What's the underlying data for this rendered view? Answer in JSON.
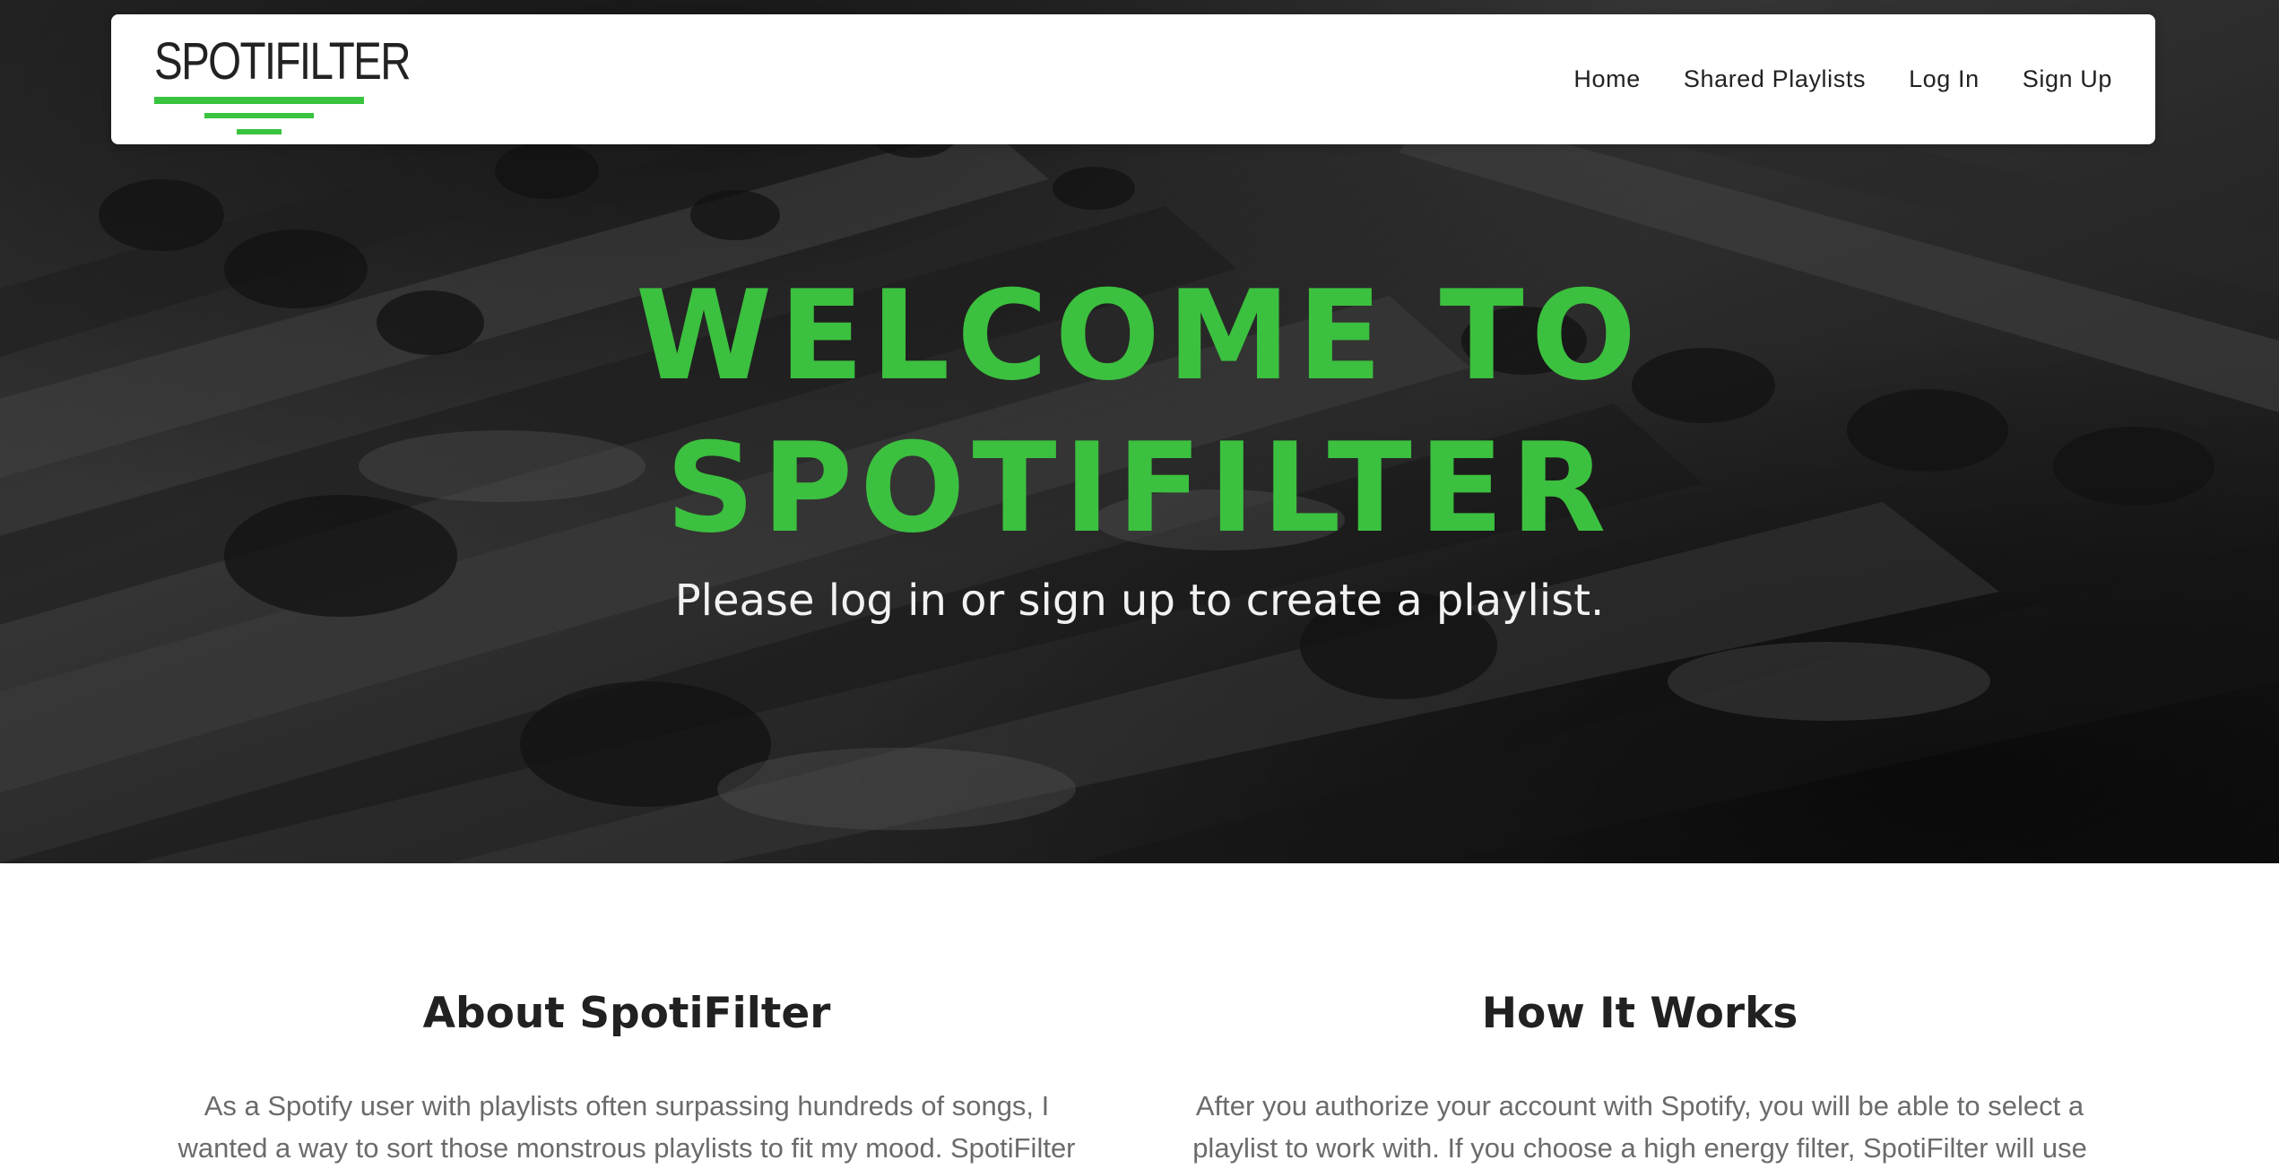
{
  "brand": {
    "logo_text": "SPOTIFILTER",
    "accent_color": "#3cc03f"
  },
  "nav": {
    "items": [
      {
        "label": "Home"
      },
      {
        "label": "Shared Playlists"
      },
      {
        "label": "Log In"
      },
      {
        "label": "Sign Up"
      }
    ]
  },
  "hero": {
    "title_line1": "WELCOME TO",
    "title_line2": "SPOTIFILTER",
    "subtitle": "Please log in or sign up to create a playlist.",
    "background": "grayscale mixing console photo"
  },
  "about": {
    "heading": "About SpotiFilter",
    "text": "As a Spotify user with playlists often surpassing hundreds of songs, I wanted a way to sort those monstrous playlists to fit my mood. SpotiFilter"
  },
  "how": {
    "heading": "How It Works",
    "text": "After you authorize your account with Spotify, you will be able to select a playlist to work with. If you choose a high energy filter, SpotiFilter will use"
  }
}
